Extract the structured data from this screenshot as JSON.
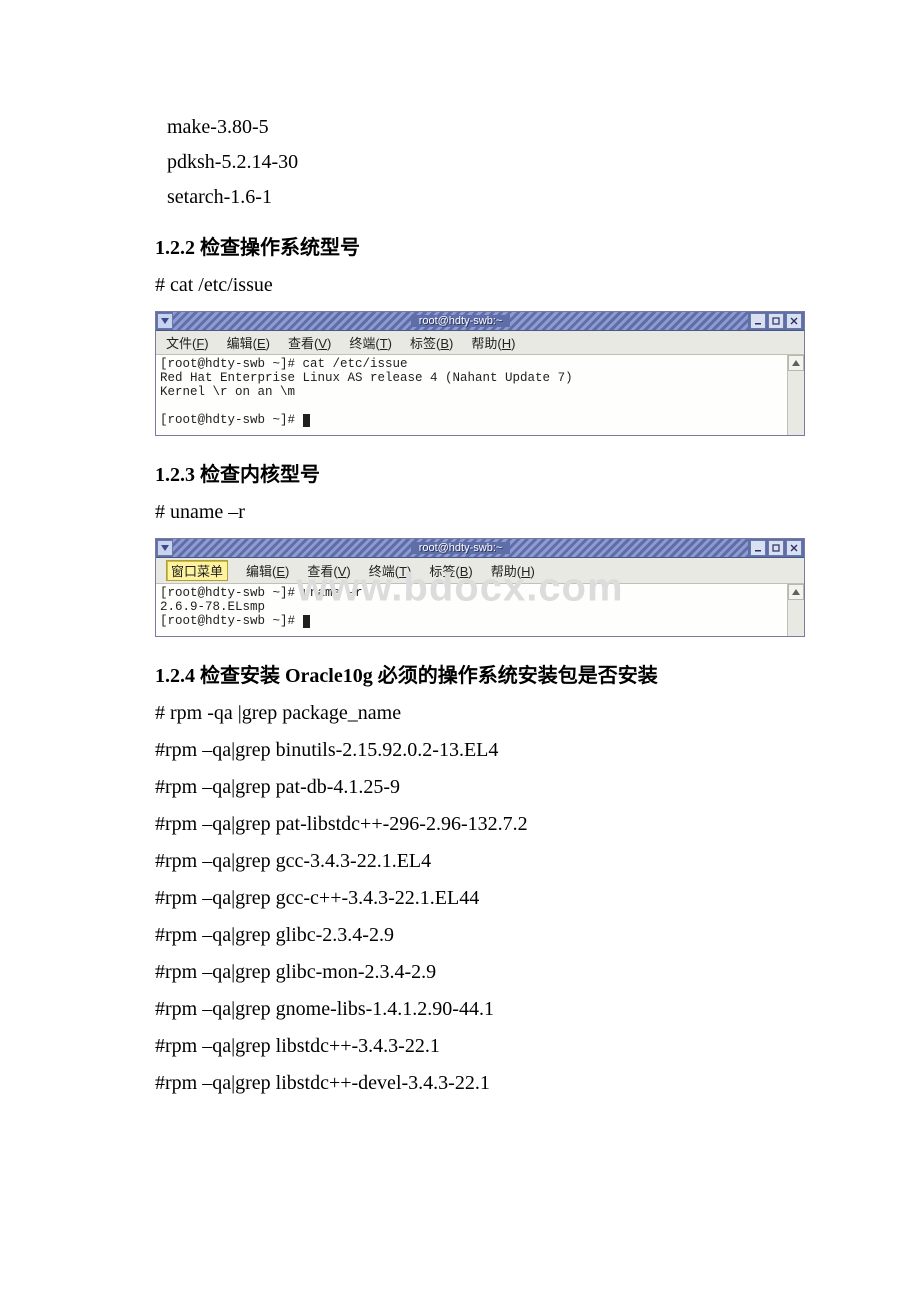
{
  "bullets": {
    "make": "make-3.80-5",
    "pdksh": "pdksh-5.2.14-30",
    "setarch": "setarch-1.6-1"
  },
  "section122": {
    "heading": "1.2.2 检查操作系统型号",
    "cmd": "# cat /etc/issue"
  },
  "term1": {
    "title": "root@hdty-swb:~",
    "menu": {
      "file": "文件(",
      "file_u": "F",
      "file_end": ")",
      "edit": "编辑(",
      "edit_u": "E",
      "edit_end": ")",
      "view": "查看(",
      "view_u": "V",
      "view_end": ")",
      "terminal": "终端(",
      "terminal_u": "T",
      "terminal_end": ")",
      "tabs": "标签(",
      "tabs_u": "B",
      "tabs_end": ")",
      "help": "帮助(",
      "help_u": "H",
      "help_end": ")"
    },
    "line1": "[root@hdty-swb ~]# cat /etc/issue",
    "line2": "Red Hat Enterprise Linux AS release 4 (Nahant Update 7)",
    "line3": "Kernel \\r on an \\m",
    "line4": "",
    "line5": "[root@hdty-swb ~]# "
  },
  "section123": {
    "heading": "1.2.3 检查内核型号",
    "cmd": "# uname –r"
  },
  "term2": {
    "title": "root@hdty-swb:~",
    "menubtn": "窗口菜单",
    "menu": {
      "edit": "编辑(",
      "edit_u": "E",
      "edit_end": ")",
      "view": "查看(",
      "view_u": "V",
      "view_end": ")",
      "terminal": "终端(",
      "terminal_u": "T",
      "terminal_end": ")",
      "tabs": "标签(",
      "tabs_u": "B",
      "tabs_end": ")",
      "help": "帮助(",
      "help_u": "H",
      "help_end": ")"
    },
    "line1": "[root@hdty-swb ~]# uname -r",
    "line2": "2.6.9-78.ELsmp",
    "line3": "[root@hdty-swb ~]# "
  },
  "watermark": "www.bdocx.com",
  "section124": {
    "heading": "1.2.4 检查安装 Oracle10g 必须的操作系统安装包是否安装",
    "cmd0": "# rpm -qa |grep package_name",
    "cmds": [
      " #rpm –qa|grep binutils-2.15.92.0.2-13.EL4",
      " #rpm –qa|grep pat-db-4.1.25-9",
      "#rpm –qa|grep pat-libstdc++-296-2.96-132.7.2",
      " #rpm –qa|grep gcc-3.4.3-22.1.EL4",
      " #rpm –qa|grep gcc-c++-3.4.3-22.1.EL44",
      " #rpm –qa|grep glibc-2.3.4-2.9",
      " #rpm –qa|grep glibc-mon-2.3.4-2.9",
      " #rpm –qa|grep gnome-libs-1.4.1.2.90-44.1",
      " #rpm –qa|grep libstdc++-3.4.3-22.1",
      " #rpm –qa|grep libstdc++-devel-3.4.3-22.1"
    ]
  }
}
